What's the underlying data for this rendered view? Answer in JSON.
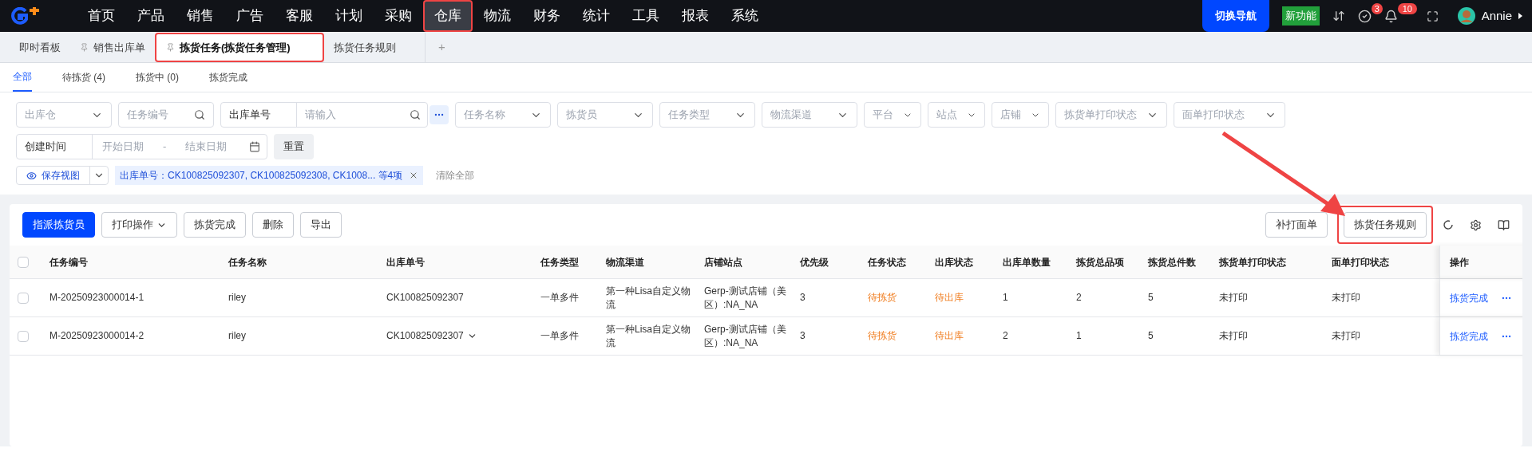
{
  "nav": {
    "items": [
      {
        "label": "首页",
        "selected": false,
        "highlighted": false
      },
      {
        "label": "产品",
        "selected": false,
        "highlighted": false
      },
      {
        "label": "销售",
        "selected": false,
        "highlighted": false
      },
      {
        "label": "广告",
        "selected": false,
        "highlighted": false
      },
      {
        "label": "客服",
        "selected": false,
        "highlighted": false
      },
      {
        "label": "计划",
        "selected": false,
        "highlighted": false
      },
      {
        "label": "采购",
        "selected": false,
        "highlighted": false
      },
      {
        "label": "仓库",
        "selected": true,
        "highlighted": true
      },
      {
        "label": "物流",
        "selected": false,
        "highlighted": false
      },
      {
        "label": "财务",
        "selected": false,
        "highlighted": false
      },
      {
        "label": "统计",
        "selected": false,
        "highlighted": false
      },
      {
        "label": "工具",
        "selected": false,
        "highlighted": false
      },
      {
        "label": "报表",
        "selected": false,
        "highlighted": false
      },
      {
        "label": "系统",
        "selected": false,
        "highlighted": false
      }
    ],
    "switch_button": "切换导航",
    "new_badge": "新功能",
    "task_count": "3",
    "notice_count": "10",
    "user": "Annie"
  },
  "page_tabs": [
    {
      "label": "即时看板",
      "pinned": false,
      "selected": false,
      "highlighted": false
    },
    {
      "label": "销售出库单",
      "pinned": true,
      "selected": false,
      "highlighted": false
    },
    {
      "label": "拣货任务(拣货任务管理)",
      "pinned": true,
      "selected": true,
      "highlighted": true
    },
    {
      "label": "拣货任务规则",
      "pinned": false,
      "selected": false,
      "highlighted": false
    }
  ],
  "add_tab": "+",
  "status_tabs": [
    {
      "label": "全部",
      "selected": true
    },
    {
      "label": "待拣货 (4)",
      "selected": false
    },
    {
      "label": "拣货中 (0)",
      "selected": false
    },
    {
      "label": "拣货完成",
      "selected": false
    }
  ],
  "filters": [
    {
      "kind": "select",
      "placeholder": "出库仓"
    },
    {
      "kind": "search",
      "placeholder": "任务编号"
    },
    {
      "kind": "combo",
      "label": "出库单号",
      "placeholder": "请输入"
    },
    {
      "kind": "select",
      "placeholder": "任务名称"
    },
    {
      "kind": "select",
      "placeholder": "拣货员"
    },
    {
      "kind": "select",
      "placeholder": "任务类型"
    },
    {
      "kind": "select",
      "placeholder": "物流渠道"
    },
    {
      "kind": "select",
      "placeholder": "平台"
    },
    {
      "kind": "select",
      "placeholder": "站点"
    },
    {
      "kind": "select",
      "placeholder": "店铺"
    },
    {
      "kind": "select",
      "placeholder": "拣货单打印状态"
    },
    {
      "kind": "select",
      "placeholder": "面单打印状态"
    }
  ],
  "date_filter": {
    "label": "创建时间",
    "start_placeholder": "开始日期",
    "separator": "-",
    "end_placeholder": "结束日期"
  },
  "reset_button": "重置",
  "save_view_button": "保存视图",
  "active_filter": {
    "label": "出库单号：CK100825092307, CK100825092308, CK1008... 等4项"
  },
  "clear_all": "清除全部",
  "toolbar": {
    "left": [
      {
        "label": "指派拣货员",
        "kind": "primary"
      },
      {
        "label": "打印操作",
        "kind": "dropdown"
      },
      {
        "label": "拣货完成",
        "kind": "default"
      },
      {
        "label": "删除",
        "kind": "default"
      },
      {
        "label": "导出",
        "kind": "default"
      }
    ],
    "right": [
      {
        "label": "补打面单",
        "highlighted": false
      },
      {
        "label": "拣货任务规则",
        "highlighted": true
      }
    ]
  },
  "table": {
    "all_checked": false,
    "columns": [
      "任务编号",
      "任务名称",
      "出库单号",
      "任务类型",
      "物流渠道",
      "店铺站点",
      "优先级",
      "任务状态",
      "出库状态",
      "出库单数量",
      "拣货总品项",
      "拣货总件数",
      "拣货单打印状态",
      "面单打印状态",
      "操作"
    ],
    "rows": [
      {
        "checked": false,
        "cells": [
          "M-20250923000014-1",
          "riley",
          "CK100825092307",
          "一单多件",
          "第一种Lisa自定义物流",
          "Gerp-测试店铺（美区）:NA_NA",
          "3",
          "待拣货",
          "待出库",
          "1",
          "2",
          "5",
          "未打印",
          "未打印"
        ],
        "expandable": false,
        "action": "拣货完成"
      },
      {
        "checked": false,
        "cells": [
          "M-20250923000014-2",
          "riley",
          "CK100825092307",
          "一单多件",
          "第一种Lisa自定义物流",
          "Gerp-测试店铺（美区）:NA_NA",
          "3",
          "待拣货",
          "待出库",
          "2",
          "1",
          "5",
          "未打印",
          "未打印"
        ],
        "expandable": true,
        "action": "拣货完成"
      }
    ]
  }
}
